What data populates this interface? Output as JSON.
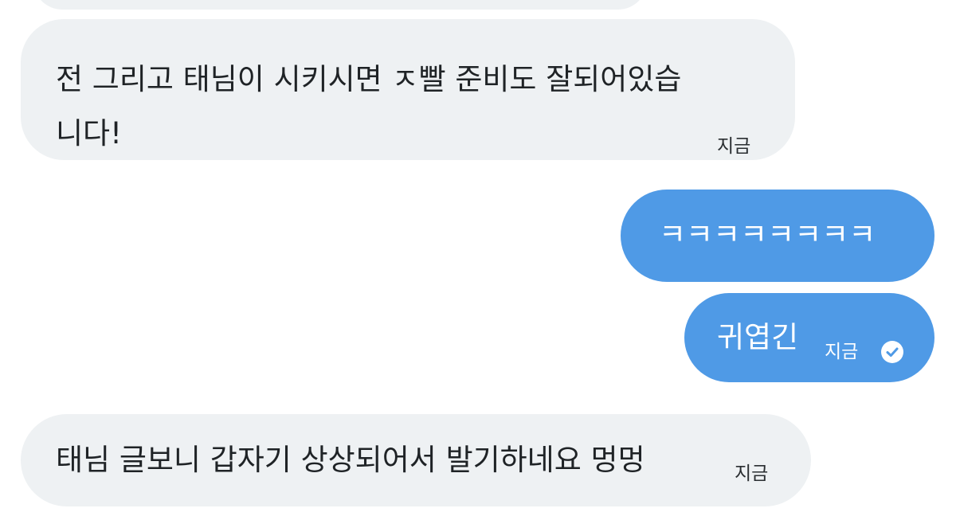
{
  "chat": {
    "messages": [
      {
        "direction": "incoming",
        "lines": [
          "전 그리고 태님이 시키시면 ㅈ빨 준비도 잘되어있습",
          "니다!"
        ],
        "time": "지금"
      },
      {
        "direction": "outgoing",
        "text": "ㅋㅋㅋㅋㅋㅋㅋㅋ"
      },
      {
        "direction": "outgoing",
        "text": "귀엽긴",
        "time": "지금",
        "status_icon": "read-check-icon"
      },
      {
        "direction": "incoming",
        "text": "태님 글보니 갑자기 상상되어서 발기하네요 멍멍",
        "time": "지금"
      }
    ]
  },
  "colors": {
    "incoming_bubble": "#eef1f3",
    "outgoing_bubble": "#4f9ae6",
    "incoming_text": "#1f2326",
    "outgoing_text": "#ffffff"
  }
}
